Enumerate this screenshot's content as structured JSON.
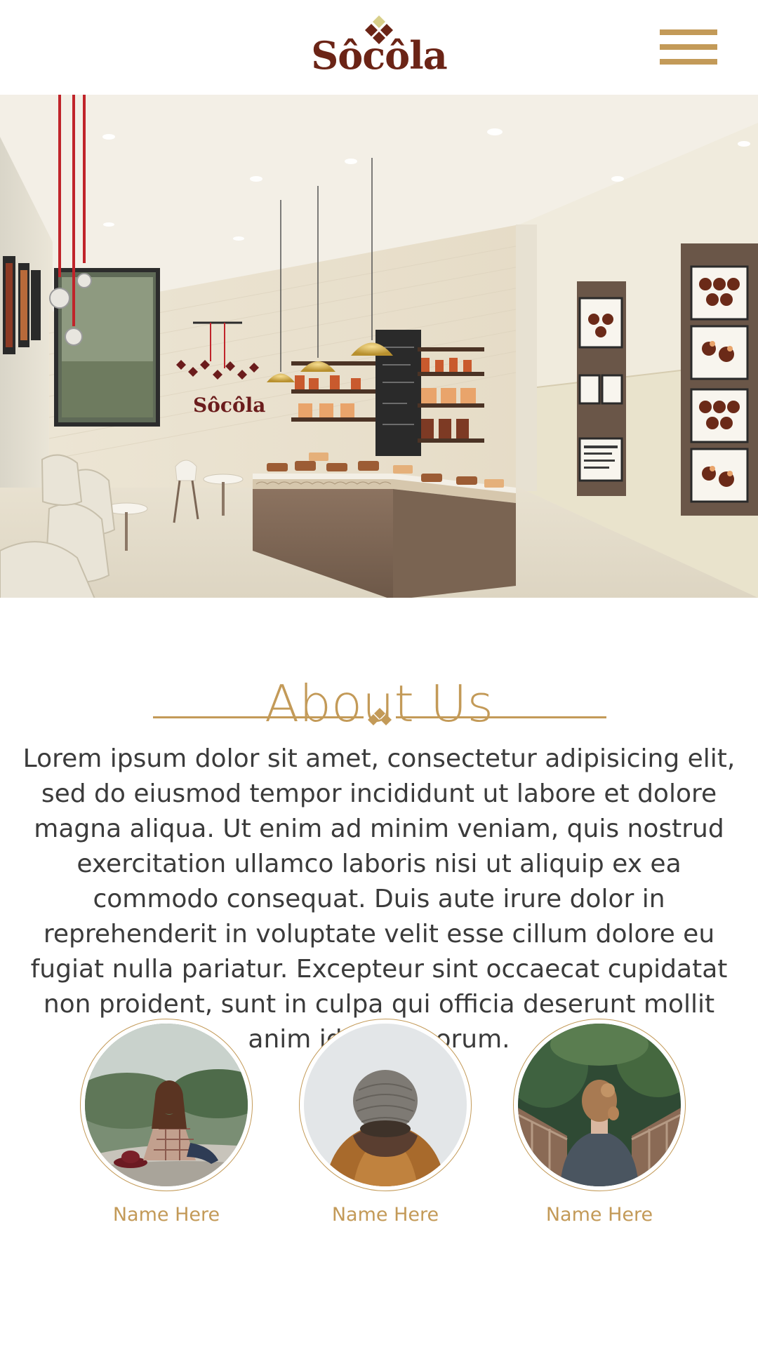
{
  "header": {
    "logo_text": "Sôcôla",
    "menu_icon": "hamburger-menu-icon",
    "accent_color": "#c39a58",
    "brand_color": "#6b2416"
  },
  "hero": {
    "sign_text": "Sôcôla"
  },
  "about": {
    "title": "About Us",
    "body": "Lorem ipsum dolor sit amet, consectetur adipisicing elit, sed do eiusmod tempor incididunt ut labore et dolore magna aliqua. Ut enim ad minim veniam, quis nostrud exercitation ullamco laboris nisi ut aliquip ex ea commodo consequat. Duis aute irure dolor in reprehenderit in voluptate velit esse cillum dolore eu fugiat nulla pariatur. Excepteur sint occaecat cupidatat non proident, sunt in culpa qui officia deserunt mollit anim id est laborum."
  },
  "team": {
    "members": [
      {
        "name": "Name Here"
      },
      {
        "name": "Name Here"
      },
      {
        "name": "Name Here"
      }
    ]
  }
}
